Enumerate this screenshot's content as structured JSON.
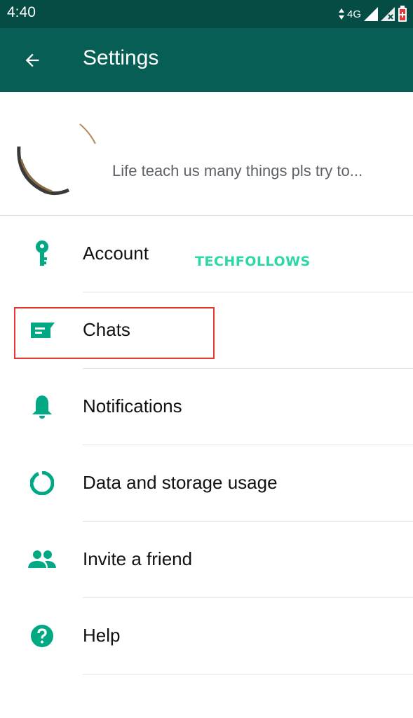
{
  "status_bar": {
    "time": "4:40",
    "network": "4G"
  },
  "header": {
    "title": "Settings"
  },
  "profile": {
    "status": "Life teach us many things pls try to..."
  },
  "watermark": "TECHFOLLOWS",
  "menu": [
    {
      "label": "Account",
      "icon": "key-icon"
    },
    {
      "label": "Chats",
      "icon": "chat-icon"
    },
    {
      "label": "Notifications",
      "icon": "bell-icon"
    },
    {
      "label": "Data and storage usage",
      "icon": "data-usage-icon"
    },
    {
      "label": "Invite a friend",
      "icon": "people-icon"
    },
    {
      "label": "Help",
      "icon": "help-icon"
    }
  ],
  "colors": {
    "status_bar": "#054d44",
    "app_bar": "#075e54",
    "accent": "#00a884",
    "highlight": "#e53935"
  }
}
